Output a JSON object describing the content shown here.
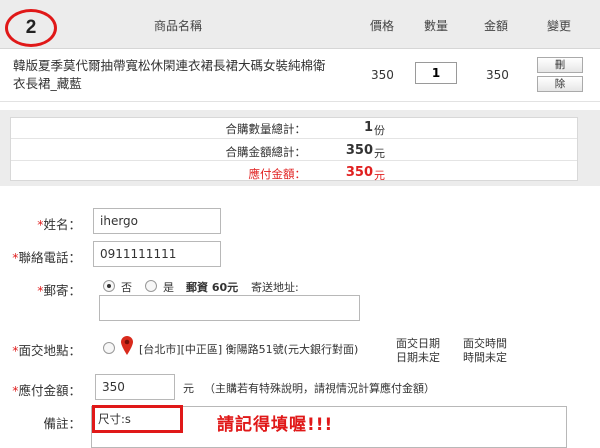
{
  "step_number": "2",
  "cart": {
    "headers": {
      "name": "商品名稱",
      "price": "價格",
      "qty": "數量",
      "amount": "金額",
      "change": "變更"
    },
    "item": {
      "name_line1": "韓版夏季莫代爾抽帶寬松休閑連衣裙長裙大碼女裝純棉衛",
      "name_line2": "衣長裙_藏藍",
      "price": "350",
      "quantity": "1",
      "amount": "350",
      "delete_label_top": "刪",
      "delete_label_bottom": "除"
    }
  },
  "summary": {
    "total_qty_label": "合購數量總計：",
    "total_qty": "1",
    "total_qty_unit": "份",
    "total_amount_label": "合購金額總計：",
    "total_amount": "350",
    "total_amount_unit": "元",
    "payable_label": "應付金額：",
    "payable": "350",
    "payable_unit": "元"
  },
  "form": {
    "name_label": "姓名：",
    "name_value": "ihergo",
    "phone_label": "聯絡電話：",
    "phone_value": "0911111111",
    "mail_label": "郵寄：",
    "mail_no": "否",
    "mail_yes": "是",
    "postage_text": "郵資 60元",
    "address_label": "寄送地址:",
    "meet_label": "面交地點：",
    "meet_place": "[台北市][中正區] 衡陽路51號(元大銀行對面)",
    "meet_date_title": "面交日期",
    "meet_date_value": "日期未定",
    "meet_time_title": "面交時間",
    "meet_time_value": "時間未定",
    "payable_label": "應付金額：",
    "payable_value": "350",
    "payable_unit": "元",
    "payable_note": "（主購若有特殊說明，請視情況計算應付金額）",
    "remark_label": "備註：",
    "remark_value": "尺寸:s",
    "remark_annotation": "請記得填喔!!!"
  },
  "colors": {
    "accent_red": "#e01818",
    "header_bg": "#ececec"
  }
}
